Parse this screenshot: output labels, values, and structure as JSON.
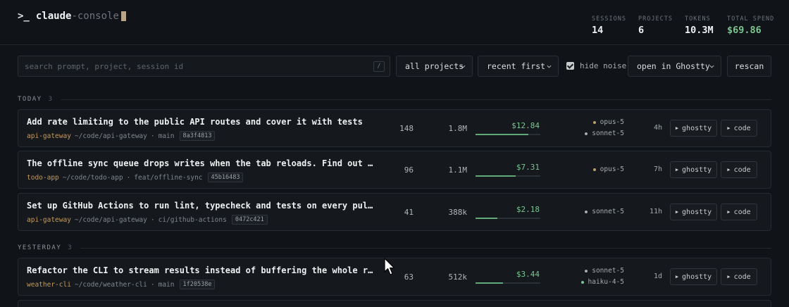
{
  "app": {
    "prompt": ">_",
    "name": "claude",
    "name_suffix": "-console"
  },
  "stats": [
    {
      "label": "SESSIONS",
      "value": "14"
    },
    {
      "label": "PROJECTS",
      "value": "6"
    },
    {
      "label": "TOKENS",
      "value": "10.3M"
    },
    {
      "label": "TOTAL SPEND",
      "value": "$69.86",
      "color": "#7cc492"
    }
  ],
  "toolbar": {
    "search_placeholder": "search prompt, project, session id",
    "search_shortcut": "/",
    "project_filter": "all projects",
    "sort": "recent first",
    "hide_noise_label": "hide noise",
    "hide_noise_checked": true,
    "open_in": "open in Ghostty",
    "rescan_label": "rescan"
  },
  "colors": {
    "opus": "#b89d6f",
    "sonnet": "#a6abb0",
    "haiku": "#7cc492",
    "spend": "#7cc492",
    "project": "#c49a5c"
  },
  "groups": [
    {
      "name": "TODAY",
      "count": "3",
      "sessions": [
        {
          "title": "Add rate limiting to the public API routes and cover it with tests",
          "project": "api-gateway",
          "path": "~/code/api-gateway",
          "branch": "main",
          "hash": "8a3f4813",
          "messages": "148",
          "tokens": "1.8M",
          "cost": "$12.84",
          "cost_fraction": 0.82,
          "models": [
            {
              "name": "opus-5",
              "icon": "dot-icon"
            },
            {
              "name": "sonnet-5",
              "icon": "dot-icon"
            }
          ],
          "age": "4h",
          "ghostty_label": "ghostty",
          "code_label": "code"
        },
        {
          "title": "The offline sync queue drops writes when the tab reloads. Find out why.",
          "project": "todo-app",
          "path": "~/code/todo-app",
          "branch": "feat/offline-sync",
          "hash": "45b16483",
          "messages": "96",
          "tokens": "1.1M",
          "cost": "$7.31",
          "cost_fraction": 0.62,
          "models": [
            {
              "name": "opus-5",
              "icon": "dot-icon"
            }
          ],
          "age": "7h",
          "ghostty_label": "ghostty",
          "code_label": "code"
        },
        {
          "title": "Set up GitHub Actions to run lint, typecheck and tests on every pull request",
          "project": "api-gateway",
          "path": "~/code/api-gateway",
          "branch": "ci/github-actions",
          "hash": "0472c421",
          "messages": "41",
          "tokens": "388k",
          "cost": "$2.18",
          "cost_fraction": 0.34,
          "models": [
            {
              "name": "sonnet-5",
              "icon": "dot-icon"
            }
          ],
          "age": "11h",
          "ghostty_label": "ghostty",
          "code_label": "code"
        }
      ]
    },
    {
      "name": "YESTERDAY",
      "count": "3",
      "sessions": [
        {
          "title": "Refactor the CLI to stream results instead of buffering the whole response",
          "project": "weather-cli",
          "path": "~/code/weather-cli",
          "branch": "main",
          "hash": "1f20538e",
          "messages": "63",
          "tokens": "512k",
          "cost": "$3.44",
          "cost_fraction": 0.42,
          "models": [
            {
              "name": "sonnet-5",
              "icon": "dot-icon"
            },
            {
              "name": "haiku-4-5",
              "icon": "dot-icon"
            }
          ],
          "age": "1d",
          "ghostty_label": "ghostty",
          "code_label": "code"
        }
      ]
    }
  ]
}
